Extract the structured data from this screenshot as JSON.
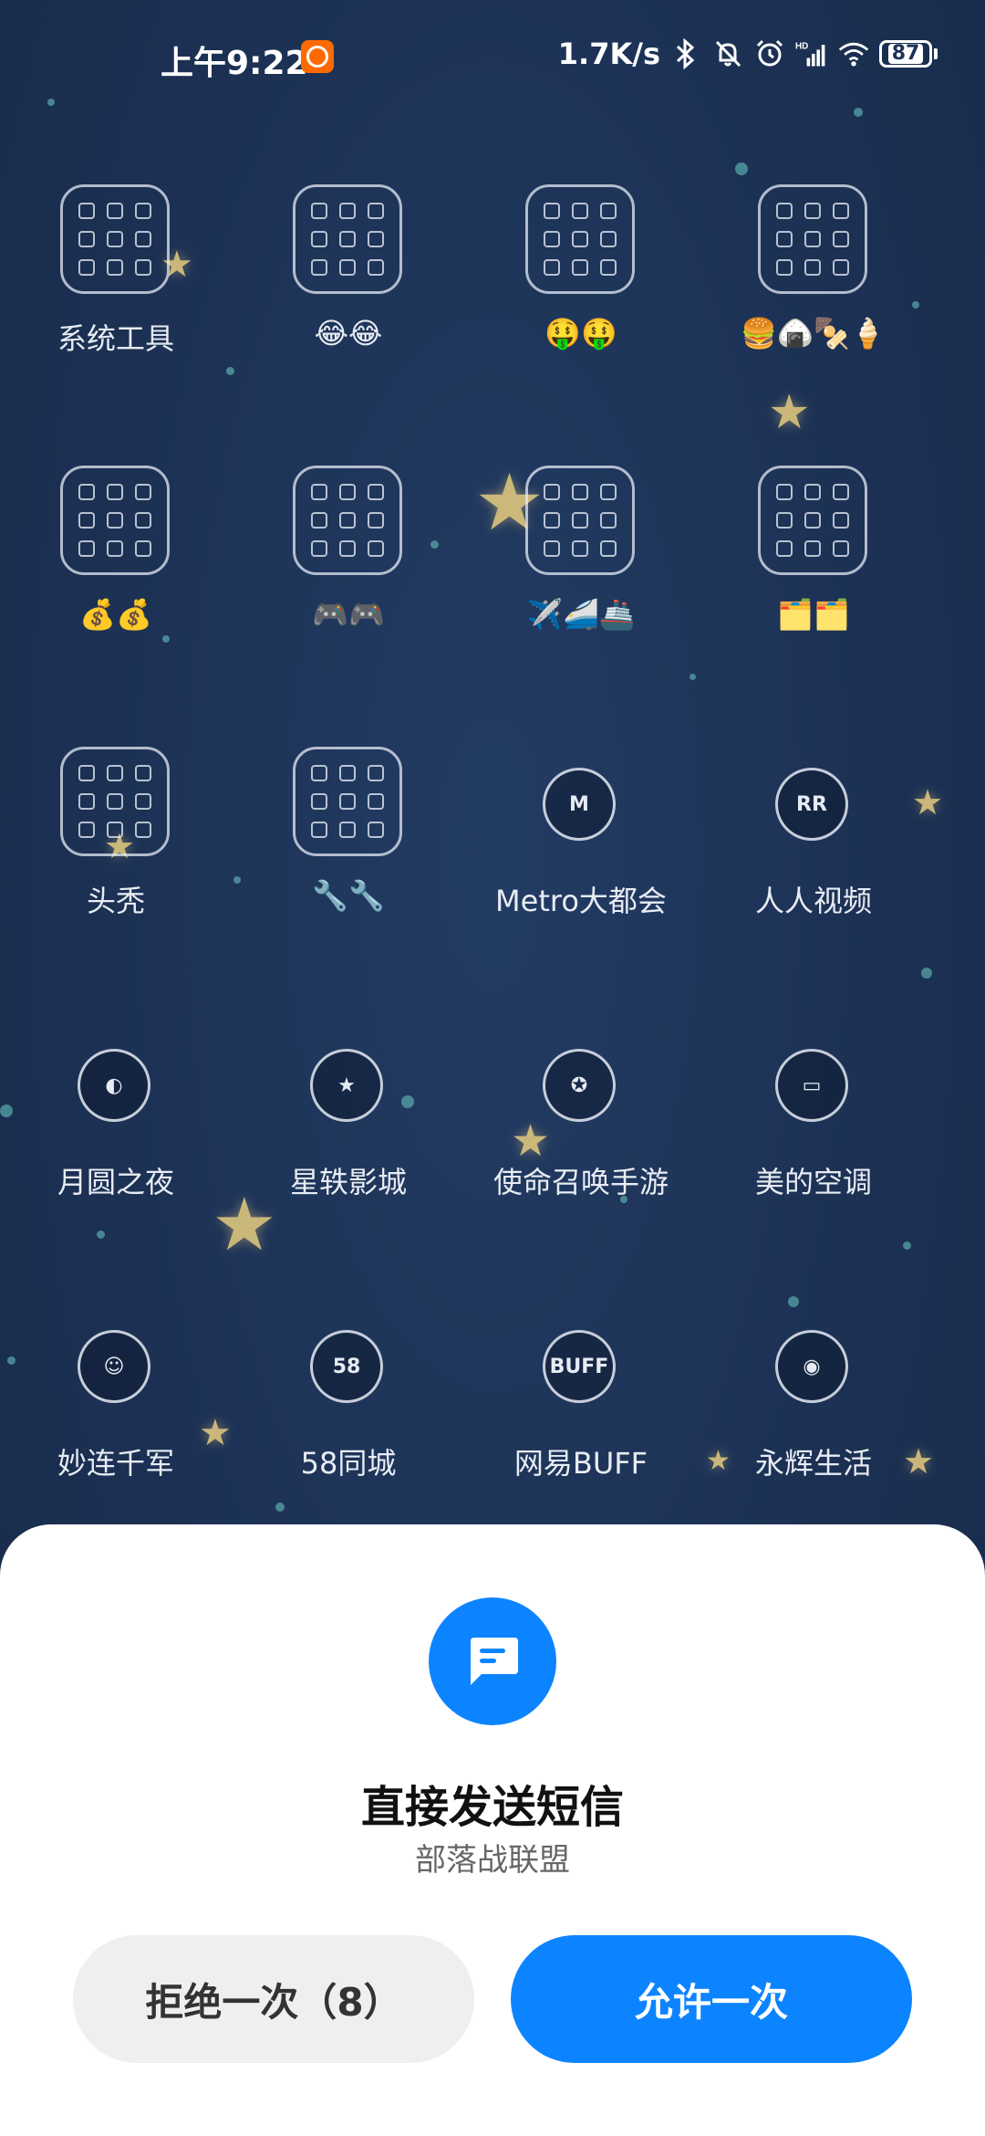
{
  "status_bar": {
    "time": "上午9:22",
    "net_speed": "1.7K/s",
    "battery": "87",
    "icons": [
      "mi-icon",
      "bluetooth-icon",
      "mute-icon",
      "alarm-icon",
      "signal-icon",
      "wifi-icon",
      "battery-icon"
    ]
  },
  "apps": [
    {
      "label": "系统工具",
      "kind": "folder"
    },
    {
      "label": "😂😂",
      "kind": "folder"
    },
    {
      "label": "🤑🤑",
      "kind": "folder"
    },
    {
      "label": "🍔🍙🍢🍦",
      "kind": "folder"
    },
    {
      "label": "💰💰",
      "kind": "folder"
    },
    {
      "label": "🎮🎮",
      "kind": "folder"
    },
    {
      "label": "✈️🚄🚢",
      "kind": "folder"
    },
    {
      "label": "🗂️🗂️",
      "kind": "folder"
    },
    {
      "label": "头秃",
      "kind": "folder"
    },
    {
      "label": "🔧🔧",
      "kind": "folder"
    },
    {
      "label": "Metro大都会",
      "kind": "app",
      "glyph": "M"
    },
    {
      "label": "人人视频",
      "kind": "app",
      "glyph": "RR"
    },
    {
      "label": "月圆之夜",
      "kind": "app",
      "glyph": "◐"
    },
    {
      "label": "星轶影城",
      "kind": "app",
      "glyph": "★"
    },
    {
      "label": "使命召唤手游",
      "kind": "app",
      "glyph": "✪"
    },
    {
      "label": "美的空调",
      "kind": "app",
      "glyph": "▭"
    },
    {
      "label": "妙连千军",
      "kind": "app",
      "glyph": "☺"
    },
    {
      "label": "58同城",
      "kind": "app",
      "glyph": "58"
    },
    {
      "label": "网易BUFF",
      "kind": "app",
      "glyph": "BUFF"
    },
    {
      "label": "永辉生活",
      "kind": "app",
      "glyph": "◉"
    }
  ],
  "dialog": {
    "title": "直接发送短信",
    "subtitle": "部落战联盟",
    "deny_label": "拒绝一次（8）",
    "allow_label": "允许一次",
    "icon": "message-icon"
  },
  "colors": {
    "accent": "#0d84ff",
    "wallpaper": "#1d3257",
    "sheet": "#ffffff",
    "deny_bg": "#efefef"
  }
}
